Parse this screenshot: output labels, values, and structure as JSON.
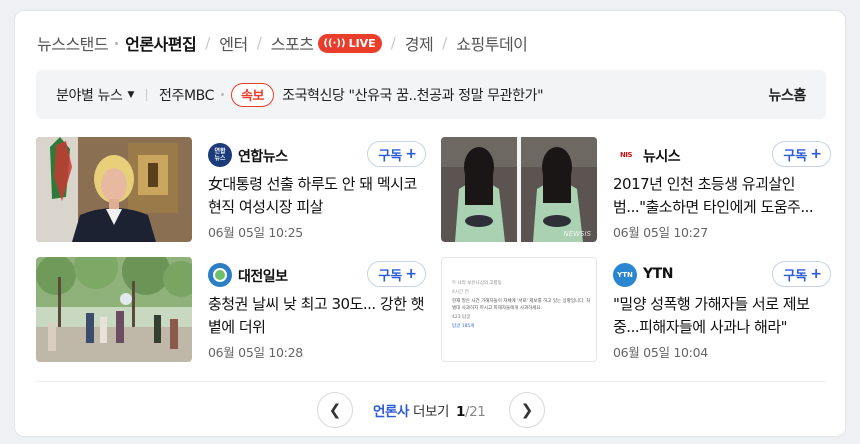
{
  "tabs": [
    {
      "label": "뉴스스탠드",
      "active": false
    },
    {
      "label": "언론사편집",
      "active": true
    },
    {
      "label": "엔터",
      "active": false
    },
    {
      "label": "스포츠",
      "active": false
    },
    {
      "label": "경제",
      "active": false
    },
    {
      "label": "쇼핑투데이",
      "active": false
    }
  ],
  "live_badge": "LIVE",
  "bar": {
    "category": "분야별 뉴스",
    "outlet": "전주MBC",
    "breaking_label": "속보",
    "headline": "조국혁신당 \"산유국 꿈..천공과 정말 무관한가\"",
    "news_home": "뉴스홈"
  },
  "cards": [
    {
      "publisher": "연합뉴스",
      "logo_text": "연합\n뉴스",
      "title": "女대통령 선출 하루도 안 돼 멕시코 현직 여성시장 피살",
      "time": "06월 05일 10:25",
      "subscribe": "구독"
    },
    {
      "publisher": "뉴시스",
      "logo_text": "NEWSIS",
      "title": "2017년 인천 초등생 유괴살인범...\"출소하면 타인에게 도움주...",
      "time": "06월 05일 10:27",
      "subscribe": "구독"
    },
    {
      "publisher": "대전일보",
      "logo_text": "",
      "title": "충청권 날씨 낮 최고 30도... 강한 햇볕에 더위",
      "time": "06월 05일 10:28",
      "subscribe": "구독"
    },
    {
      "publisher": "YTN",
      "logo_text": "YTN",
      "title": "\"밀양 성폭행 가해자들 서로 제보중...피해자들에 사과나 해라\"",
      "time": "06월 05일 10:04",
      "subscribe": "구독"
    }
  ],
  "thumb_text": {
    "newsis_watermark": "NEWSIS",
    "post_header": "두 나라 보유니심의 고향동",
    "post_meta": "4시간 전",
    "post_body": "현재 말은 사건 가해자들이 자체에 '서로' 제보를 하고 있는 상황입니다. 처벌대 사과하지 마시고 피해자들에게 사과하세요.",
    "post_actions": "423  답글",
    "post_reply": "답글 185개"
  },
  "pagination": {
    "label_blue": "언론사",
    "label": "더보기",
    "current": "1",
    "total": "/21"
  },
  "colors": {
    "accent": "#2c5bd8",
    "live": "#ea3e2c",
    "bar_bg": "#f2f4f6"
  }
}
